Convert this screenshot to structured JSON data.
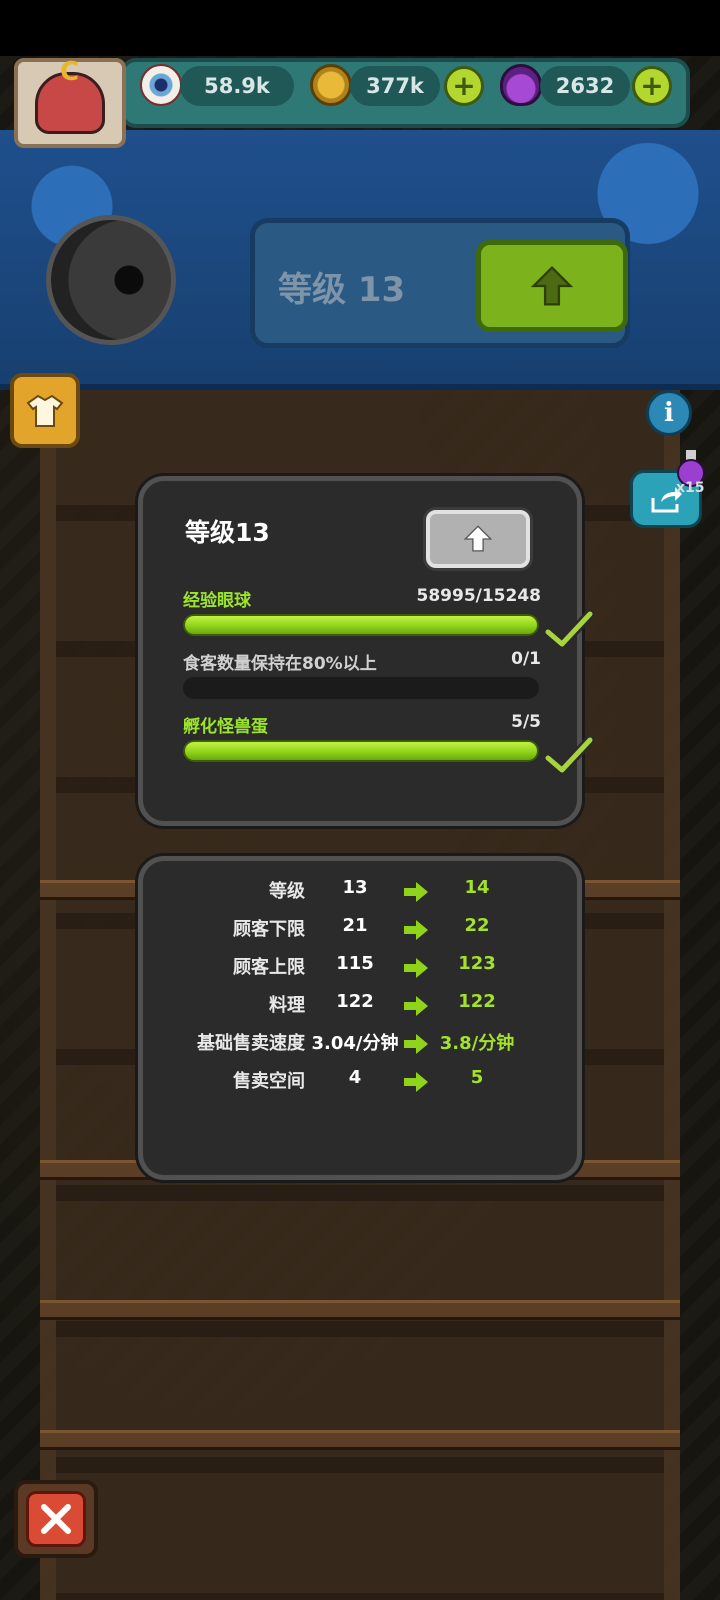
{
  "currencies": {
    "eyeballs": "58.9k",
    "coins": "377k",
    "potions": "2632"
  },
  "banner": {
    "level_text": "等级 13"
  },
  "side": {
    "potion_count": "x15"
  },
  "upgrade_panel": {
    "title": "等级13",
    "requirements": [
      {
        "label": "经验眼球",
        "value": "58995/15248",
        "progress": 1.0,
        "met": true,
        "label_color": "#9be52a"
      },
      {
        "label": "食客数量保持在80%以上",
        "value": "0/1",
        "progress": 0.0,
        "met": false,
        "label_color": "#d0d0d0"
      },
      {
        "label": "孵化怪兽蛋",
        "value": "5/5",
        "progress": 1.0,
        "met": true,
        "label_color": "#9be52a"
      }
    ]
  },
  "stats_panel": {
    "rows": [
      {
        "label": "等级",
        "from": "13",
        "to": "14"
      },
      {
        "label": "顾客下限",
        "from": "21",
        "to": "22"
      },
      {
        "label": "顾客上限",
        "from": "115",
        "to": "123"
      },
      {
        "label": "料理",
        "from": "122",
        "to": "122"
      },
      {
        "label": "基础售卖速度",
        "from": "3.04/分钟",
        "to": "3.8/分钟"
      },
      {
        "label": "售卖空间",
        "from": "4",
        "to": "5"
      }
    ]
  },
  "colors": {
    "accent_green": "#a3e22b",
    "panel_bg": "#2b2b2b"
  }
}
